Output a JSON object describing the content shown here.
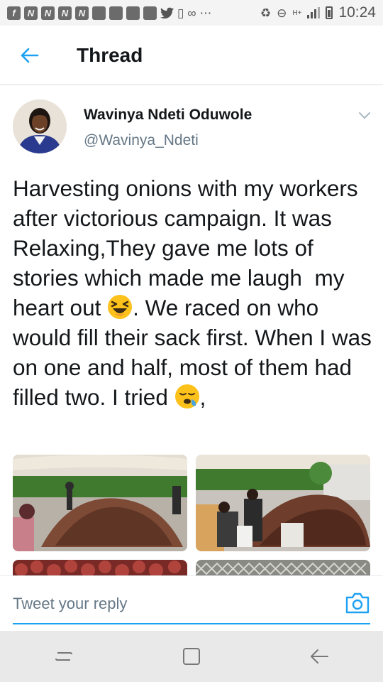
{
  "status_bar": {
    "time": "10:24",
    "network_label": "H+",
    "notification_icons": [
      "facebook-icon",
      "n-icon",
      "n-icon",
      "n-icon",
      "n-icon",
      "app-icon",
      "app-icon",
      "app-icon",
      "app-icon",
      "twitter-icon",
      "alert-icon",
      "voicemail-icon",
      "more-dots-icon",
      "recycle-icon",
      "minus-circle-icon"
    ]
  },
  "header": {
    "title": "Thread"
  },
  "tweet": {
    "display_name": "Wavinya Ndeti Oduwole",
    "handle": "@Wavinya_Ndeti",
    "text_part1": "Harvesting onions with my workers after victorious campaign. It was Relaxing,They gave me lots of stories which made me laugh  my heart out ",
    "text_part2": ". We raced on who would fill their sack first. When I was on one and half, most of them had filled two. I tried ",
    "text_part3": ",",
    "emoji_1": "laughing-face",
    "emoji_2": "sleepy-face"
  },
  "reply": {
    "placeholder": "Tweet your reply"
  },
  "colors": {
    "accent": "#1da1f2",
    "text": "#14171a",
    "secondary_text": "#657786"
  }
}
